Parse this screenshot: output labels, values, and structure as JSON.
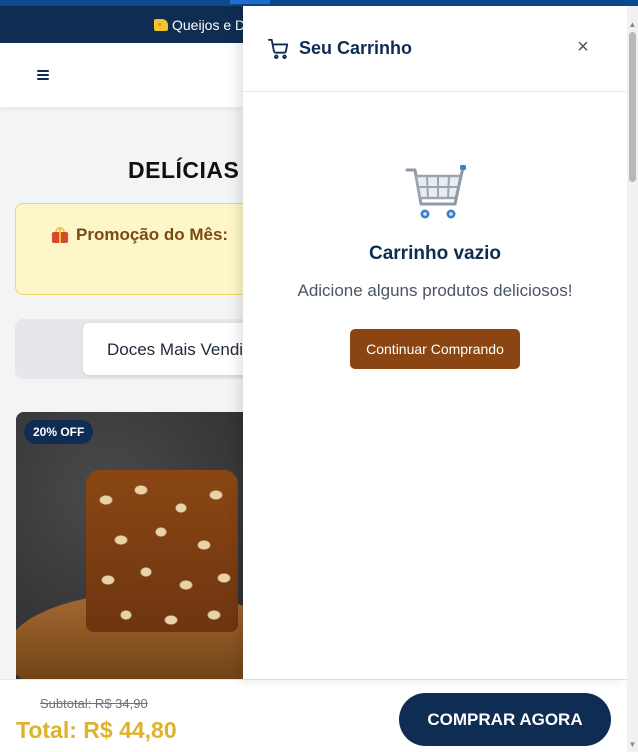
{
  "topbar": {
    "text": "Queijos e D",
    "icon": "cheese-icon"
  },
  "header": {
    "menu_icon": "hamburger-menu-icon"
  },
  "page": {
    "title": "DELÍCIAS",
    "promo": {
      "icon": "gift-icon",
      "text": "Promoção do Mês:"
    },
    "active_tab": "Doces Mais Vendidos",
    "product": {
      "badge": "20% OFF"
    }
  },
  "bottom_bar": {
    "subtotal": "Subtotal: R$ 34,90",
    "total": "Total: R$ 44,80",
    "buy_label": "COMPRAR AGORA"
  },
  "cart_drawer": {
    "title": "Seu Carrinho",
    "close_symbol": "×",
    "empty_title": "Carrinho vazio",
    "empty_message": "Adicione alguns produtos deliciosos!",
    "continue_label": "Continuar Comprando"
  },
  "colors": {
    "navy": "#0f2d52",
    "gold": "#e0b12a",
    "brown_button": "#8b4513",
    "promo_bg": "#fdf6c8"
  }
}
